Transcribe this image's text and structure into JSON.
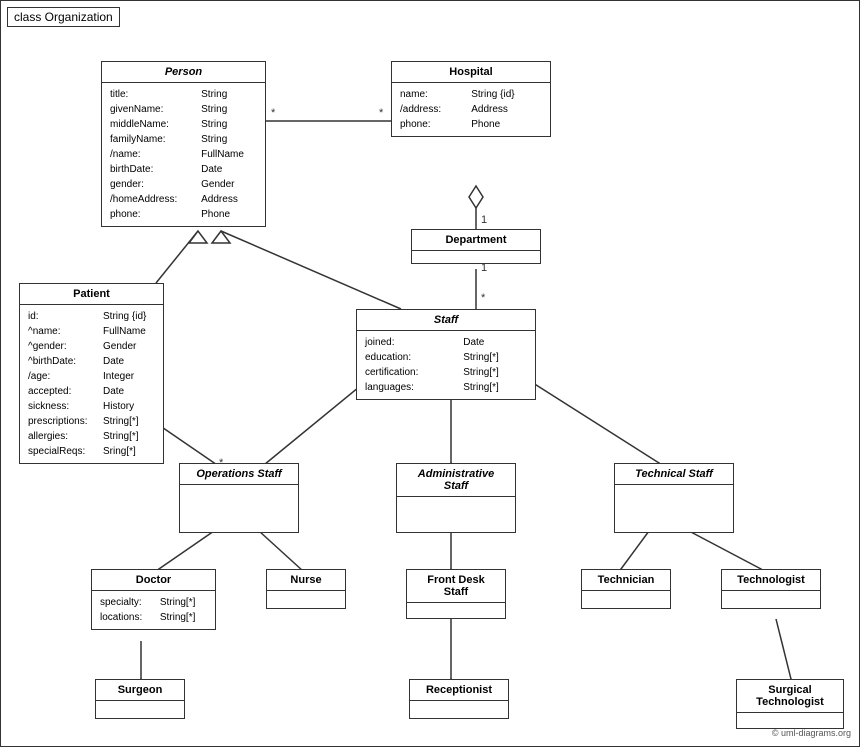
{
  "diagram": {
    "title": "class Organization",
    "copyright": "© uml-diagrams.org",
    "classes": {
      "person": {
        "name": "Person",
        "italic": true,
        "attrs": [
          [
            "title:",
            "String"
          ],
          [
            "givenName:",
            "String"
          ],
          [
            "middleName:",
            "String"
          ],
          [
            "familyName:",
            "String"
          ],
          [
            "/name:",
            "FullName"
          ],
          [
            "birthDate:",
            "Date"
          ],
          [
            "gender:",
            "Gender"
          ],
          [
            "/homeAddress:",
            "Address"
          ],
          [
            "phone:",
            "Phone"
          ]
        ]
      },
      "hospital": {
        "name": "Hospital",
        "attrs": [
          [
            "name:",
            "String {id}"
          ],
          [
            "/address:",
            "Address"
          ],
          [
            "phone:",
            "Phone"
          ]
        ]
      },
      "department": {
        "name": "Department",
        "attrs": []
      },
      "staff": {
        "name": "Staff",
        "italic": true,
        "attrs": [
          [
            "joined:",
            "Date"
          ],
          [
            "education:",
            "String[*]"
          ],
          [
            "certification:",
            "String[*]"
          ],
          [
            "languages:",
            "String[*]"
          ]
        ]
      },
      "patient": {
        "name": "Patient",
        "attrs": [
          [
            "id:",
            "String {id}"
          ],
          [
            "^name:",
            "FullName"
          ],
          [
            "^gender:",
            "Gender"
          ],
          [
            "^birthDate:",
            "Date"
          ],
          [
            "/age:",
            "Integer"
          ],
          [
            "accepted:",
            "Date"
          ],
          [
            "sickness:",
            "History"
          ],
          [
            "prescriptions:",
            "String[*]"
          ],
          [
            "allergies:",
            "String[*]"
          ],
          [
            "specialReqs:",
            "Sring[*]"
          ]
        ]
      },
      "operations_staff": {
        "name": "Operations Staff",
        "italic": true,
        "attrs": []
      },
      "administrative_staff": {
        "name": "Administrative Staff",
        "italic": true,
        "attrs": []
      },
      "technical_staff": {
        "name": "Technical Staff",
        "italic": true,
        "attrs": []
      },
      "doctor": {
        "name": "Doctor",
        "attrs": [
          [
            "specialty:",
            "String[*]"
          ],
          [
            "locations:",
            "String[*]"
          ]
        ]
      },
      "nurse": {
        "name": "Nurse",
        "attrs": []
      },
      "front_desk_staff": {
        "name": "Front Desk Staff",
        "attrs": []
      },
      "technician": {
        "name": "Technician",
        "attrs": []
      },
      "technologist": {
        "name": "Technologist",
        "attrs": []
      },
      "surgeon": {
        "name": "Surgeon",
        "attrs": []
      },
      "receptionist": {
        "name": "Receptionist",
        "attrs": []
      },
      "surgical_technologist": {
        "name": "Surgical Technologist",
        "attrs": []
      }
    }
  }
}
